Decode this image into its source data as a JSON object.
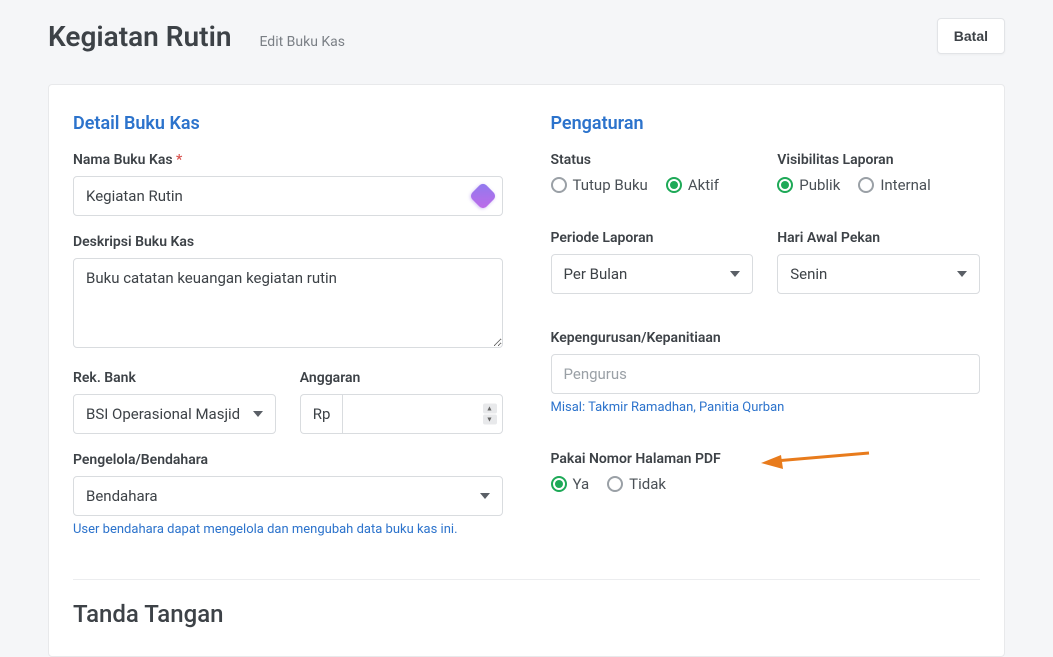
{
  "header": {
    "title": "Kegiatan Rutin",
    "subtitle": "Edit Buku Kas",
    "cancel": "Batal"
  },
  "detail": {
    "section_title": "Detail Buku Kas",
    "name_label": "Nama Buku Kas",
    "name_value": "Kegiatan Rutin",
    "desc_label": "Deskripsi Buku Kas",
    "desc_value": "Buku catatan keuangan kegiatan rutin",
    "bank_label": "Rek. Bank",
    "bank_value": "BSI Operasional Masjid",
    "budget_label": "Anggaran",
    "budget_prefix": "Rp",
    "budget_value": "",
    "manager_label": "Pengelola/Bendahara",
    "manager_value": "Bendahara",
    "manager_helper": "User bendahara dapat mengelola dan mengubah data buku kas ini."
  },
  "settings": {
    "section_title": "Pengaturan",
    "status_label": "Status",
    "status_options": {
      "close": "Tutup Buku",
      "active": "Aktif"
    },
    "status_value": "Aktif",
    "visibility_label": "Visibilitas Laporan",
    "visibility_options": {
      "public": "Publik",
      "internal": "Internal"
    },
    "visibility_value": "Publik",
    "period_label": "Periode Laporan",
    "period_value": "Per Bulan",
    "weekstart_label": "Hari Awal Pekan",
    "weekstart_value": "Senin",
    "committee_label": "Kepengurusan/Kepanitiaan",
    "committee_placeholder": "Pengurus",
    "committee_helper": "Misal: Takmir Ramadhan, Panitia Qurban",
    "pdfpage_label": "Pakai Nomor Halaman PDF",
    "pdfpage_options": {
      "yes": "Ya",
      "no": "Tidak"
    },
    "pdfpage_value": "Ya"
  },
  "signature": {
    "title": "Tanda Tangan"
  }
}
